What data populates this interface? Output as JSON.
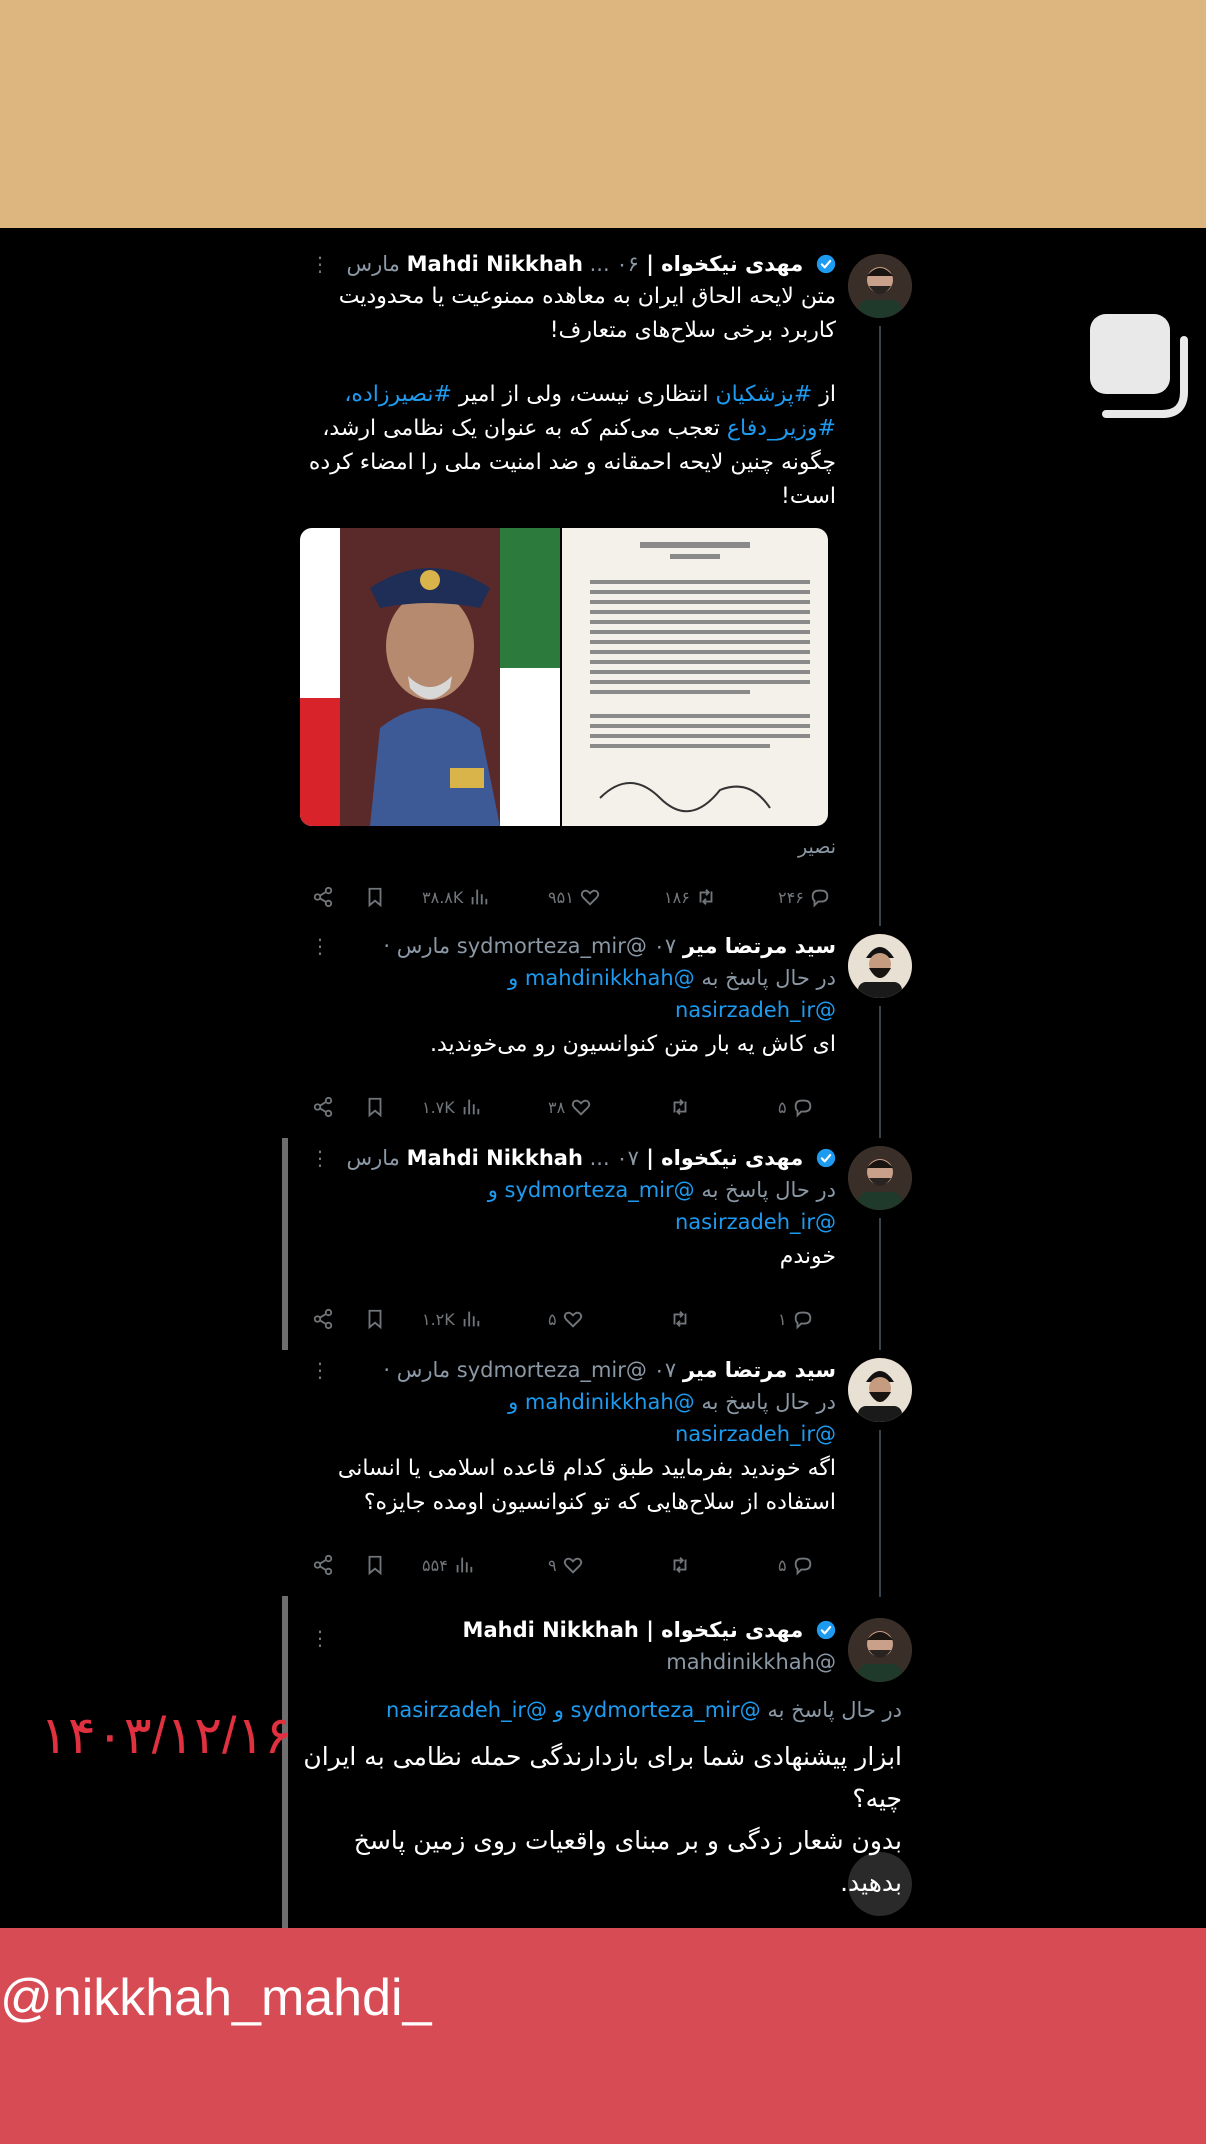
{
  "watermark": "@nikkhah_mahdi_",
  "date_stamp": "۱۴۰۳/۱۲/۱۶",
  "colors": {
    "top_band": "#dcb57f",
    "bottom_band": "#d74b55",
    "date_stamp": "#e1303f",
    "link": "#1d9bf0",
    "verified": "#1d9bf0"
  },
  "tweets": [
    {
      "name": "مهدی نیکخواه | Mahdi Nikkhah",
      "meta": "... ۰۶ مارس",
      "body_lines": [
        "متن لایحه الحاق ایران به معاهده ممنوعیت یا محدودیت",
        "کاربرد برخی سلاح‌های متعارف!"
      ],
      "body2_lines": [
        {
          "before": "از ",
          "tag": "#پزشکیان",
          "after": " انتظاری نیست، ولی از امیر ",
          "tag2": "#نصیرزاده،"
        },
        {
          "tag": "#وزیر_دفاع",
          "after": " تعجب می‌کنم که به عنوان یک نظامی ارشد،",
          "before": "",
          "tag2": ""
        },
        {
          "before": "",
          "tag": "",
          "after": "چگونه چنین لایحه احمقانه و ضد امنیت ملی را امضاء کرده",
          "tag2": ""
        },
        {
          "before": "",
          "tag": "",
          "after": "است!",
          "tag2": ""
        }
      ],
      "image_caption": "نصیر",
      "stats": {
        "replies": "۲۴۶",
        "retweets": "۱۸۶",
        "likes": "۹۵۱",
        "views": "۳۸.۸K"
      }
    },
    {
      "name": "سید مرتضا میر",
      "handle": "sydmorteza_mir@",
      "meta": "۰۷ مارس ·",
      "reply_prefix": "در حال پاسخ به",
      "reply_mentions": "@mahdinikkhah و",
      "reply_mentions2": "@nasirzadeh_ir",
      "body_lines": [
        "ای کاش یه بار متن کنوانسیون رو می‌خوندید."
      ],
      "stats": {
        "replies": "۵",
        "retweets": "",
        "likes": "۳۸",
        "views": "۱.۷K"
      }
    },
    {
      "name": "مهدی نیکخواه | Mahdi Nikkhah",
      "meta": "... ۰۷ مارس",
      "reply_prefix": "در حال پاسخ به",
      "reply_mentions": "@sydmorteza_mir و",
      "reply_mentions2": "@nasirzadeh_ir",
      "body_lines": [
        "خوندم"
      ],
      "stats": {
        "replies": "۱",
        "retweets": "",
        "likes": "۵",
        "views": "۱.۲K"
      }
    },
    {
      "name": "سید مرتضا میر",
      "handle": "sydmorteza_mir@",
      "meta": "۰۷ مارس ·",
      "reply_prefix": "در حال پاسخ به",
      "reply_mentions": "@mahdinikkhah و",
      "reply_mentions2": "@nasirzadeh_ir",
      "body_lines": [
        "اگه خوندید بفرمایید طبق کدام قاعده اسلامی یا انسانی",
        "استفاده از سلاح‌هایی که تو کنوانسیون اومده جایزه؟"
      ],
      "stats": {
        "replies": "۵",
        "retweets": "",
        "likes": "۹",
        "views": "۵۵۴"
      }
    },
    {
      "name": "مهدی نیکخواه | Mahdi Nikkhah",
      "handle": "@mahdinikkhah",
      "reply_prefix": "در حال پاسخ به",
      "reply_mentions": "@sydmorteza_mir و @nasirzadeh_ir",
      "body_lines": [
        "ابزار پیشنهادی شما برای بازدارندگی حمله نظامی به ایران",
        "چیه؟",
        "بدون شعار زدگی و بر مبنای واقعیات روی زمین پاسخ",
        "بدهید."
      ]
    }
  ]
}
